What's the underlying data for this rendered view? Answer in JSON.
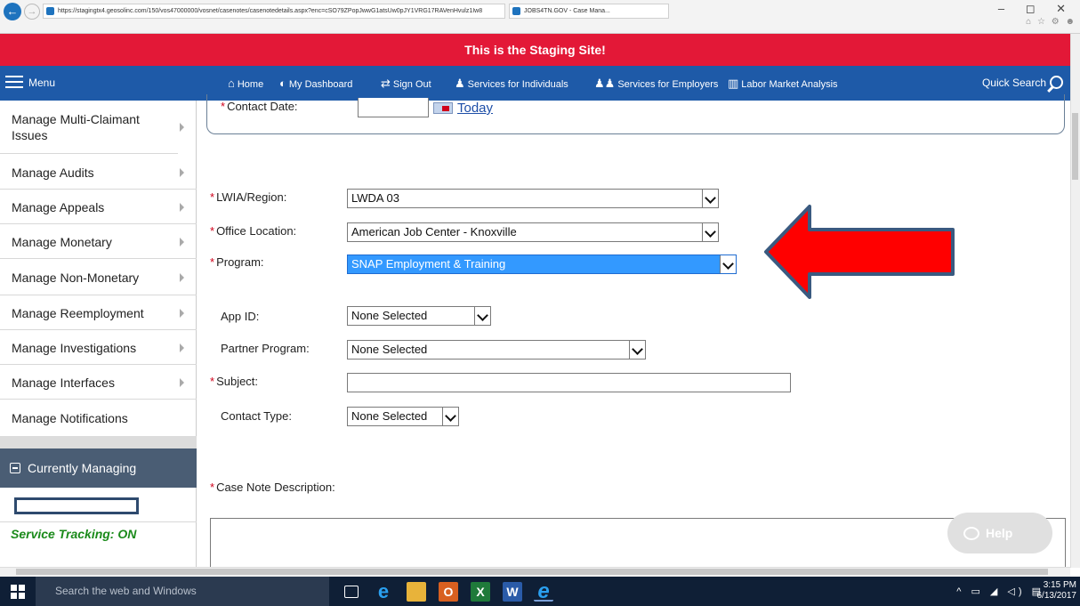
{
  "browser": {
    "url": "https://stagingtx4.geosolinc.com/150/vos47000000/vosnet/casenotes/casenotedetails.aspx?enc=cSO79ZPopJwwG1atsUw0pJY1VRG17RAVenHvulz1Iw8",
    "tab_title": "JOBS4TN.GOV - Case Mana...",
    "window_controls": "– ◻ ✕",
    "fav_icons": "⌂ ☆ ⚙ ☻"
  },
  "banner": {
    "text": "This is the Staging Site!"
  },
  "nav": {
    "menu_label": "Menu",
    "links": [
      {
        "label": "Home",
        "icon": "home-icon",
        "glyph": "⌂"
      },
      {
        "label": "My Dashboard",
        "icon": "dashboard-icon",
        "glyph": "◐"
      },
      {
        "label": "Sign Out",
        "icon": "sign-out-icon",
        "glyph": "⇄"
      },
      {
        "label": "Services for Individuals",
        "icon": "person-icon",
        "glyph": "♟"
      },
      {
        "label": "Services for Employers",
        "icon": "group-icon",
        "glyph": "♟♟"
      },
      {
        "label": "Labor Market Analysis",
        "icon": "chart-icon",
        "glyph": "▥"
      }
    ],
    "quick_search": "Quick Search"
  },
  "sidebar": {
    "items": [
      {
        "label": "Manage Multi-Claimant Issues"
      },
      {
        "label": "Manage Audits"
      },
      {
        "label": "Manage Appeals"
      },
      {
        "label": "Manage Monetary"
      },
      {
        "label": "Manage Non-Monetary"
      },
      {
        "label": "Manage Reemployment"
      },
      {
        "label": "Manage Investigations"
      },
      {
        "label": "Manage Interfaces"
      },
      {
        "label": "Manage Notifications"
      }
    ],
    "currently_managing": "Currently Managing",
    "service_tracking": "Service Tracking: ON"
  },
  "form": {
    "required_mark": "*",
    "contact_date": {
      "label": "Contact Date:",
      "today": "Today"
    },
    "lwia": {
      "label": "LWIA/Region:",
      "value": "LWDA 03"
    },
    "office": {
      "label": "Office Location:",
      "value": "American Job Center - Knoxville"
    },
    "program": {
      "label": "Program:",
      "value": "SNAP Employment & Training"
    },
    "app_id": {
      "label": "App ID:",
      "value": "None Selected"
    },
    "partner": {
      "label": "Partner Program:",
      "value": "None Selected"
    },
    "subject": {
      "label": "Subject:",
      "value": ""
    },
    "contact_type": {
      "label": "Contact Type:",
      "value": "None Selected"
    },
    "description": {
      "label": "Case Note Description:"
    }
  },
  "help": {
    "label": "Help"
  },
  "annotation": {
    "color": "#ff0000",
    "border": "#3a5a80"
  },
  "taskbar": {
    "search_placeholder": "Search the web and Windows",
    "time": "3:15 PM",
    "date": "6/13/2017",
    "tray": "^ ▭ ◢ ◁) ▤"
  }
}
